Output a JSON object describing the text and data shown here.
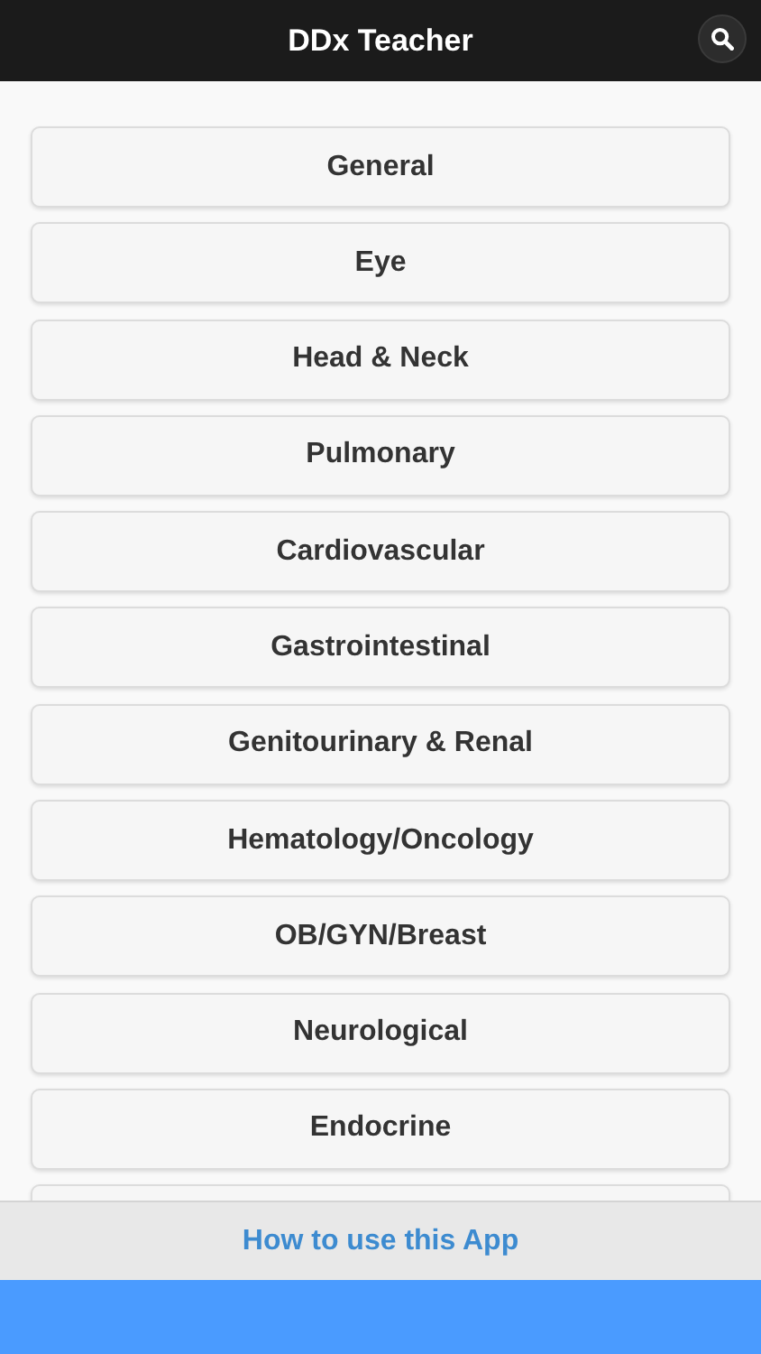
{
  "header": {
    "title": "DDx Teacher"
  },
  "items": [
    {
      "kind": "button",
      "label": "General"
    },
    {
      "kind": "button",
      "label": "Eye"
    },
    {
      "kind": "button",
      "label": "Head & Neck"
    },
    {
      "kind": "button",
      "label": "Pulmonary"
    },
    {
      "kind": "button",
      "label": "Cardiovascular"
    },
    {
      "kind": "button",
      "label": "Gastrointestinal"
    },
    {
      "kind": "button",
      "label": "Genitourinary & Renal"
    },
    {
      "kind": "button",
      "label": "Hematology/Oncology"
    },
    {
      "kind": "button",
      "label": "OB/GYN/Breast"
    },
    {
      "kind": "button",
      "label": "Neurological"
    },
    {
      "kind": "button",
      "label": "Endocrine"
    },
    {
      "kind": "cut-off"
    }
  ],
  "footer": {
    "link": "How to use this App"
  }
}
